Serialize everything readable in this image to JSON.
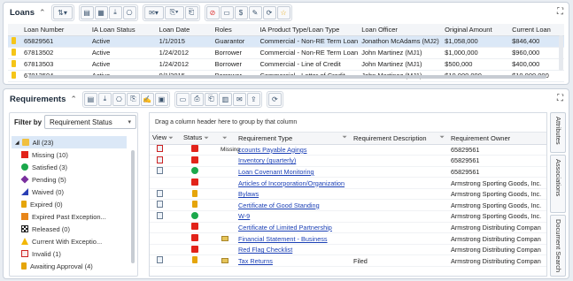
{
  "loans": {
    "title": "Loans",
    "columns": [
      "Loan Number",
      "IA Loan Status",
      "Loan Date",
      "Roles",
      "IA Product Type/Loan Type",
      "Loan Officer",
      "Original Amount",
      "Current Loan"
    ],
    "rows": [
      [
        "65829561",
        "Active",
        "1/1/2015",
        "Guarantor",
        "Commercial - Non-RE Term Loan",
        "Jonathon McAdams (MJ2)",
        "$1,058,000",
        "$846,400"
      ],
      [
        "67813502",
        "Active",
        "1/24/2012",
        "Borrower",
        "Commercial - Non-RE Term Loan",
        "John Martinez (MJ1)",
        "$1,000,000",
        "$960,000"
      ],
      [
        "67813503",
        "Active",
        "1/24/2012",
        "Borrower",
        "Commercial - Line of Credit",
        "John Martinez (MJ1)",
        "$500,000",
        "$400,000"
      ],
      [
        "67813504",
        "Active",
        "9/1/2015",
        "Borrower",
        "Commercial - Letter of Credit",
        "John Martinez (MJ1)",
        "$10,000,000",
        "$10,000,000"
      ]
    ]
  },
  "requirements": {
    "title": "Requirements",
    "filter_label": "Filter by",
    "filter_value": "Requirement Status",
    "filter_items": [
      {
        "label": "All (23)",
        "icon": "folder-icon",
        "color": "#f0c040"
      },
      {
        "label": "Missing (10)",
        "icon": "red-square-icon",
        "color": "#e2231a"
      },
      {
        "label": "Satisfied (3)",
        "icon": "green-circle-icon",
        "color": "#1aa84b"
      },
      {
        "label": "Pending (5)",
        "icon": "purple-diamond-icon",
        "color": "#7a2f9e"
      },
      {
        "label": "Waived (0)",
        "icon": "blue-triangle-icon",
        "color": "#2a3fb5"
      },
      {
        "label": "Expired (0)",
        "icon": "lock-icon",
        "color": "#e5a50a"
      },
      {
        "label": "Expired Past Exception...",
        "icon": "orange-square-icon",
        "color": "#e8861a"
      },
      {
        "label": "Released (0)",
        "icon": "checkered-flag-icon",
        "color": "#222222"
      },
      {
        "label": "Current With Exceptio...",
        "icon": "warning-icon",
        "color": "#f2b705"
      },
      {
        "label": "Invalid (1)",
        "icon": "invalid-doc-icon",
        "color": "#c22222"
      },
      {
        "label": "Awaiting Approval (4)",
        "icon": "lock-icon",
        "color": "#e5a50a"
      }
    ],
    "group_hint": "Drag a column header here to group by that column",
    "columns": {
      "view": "View",
      "status": "Status",
      "type": "Requirement Type",
      "desc": "Requirement Description",
      "owner": "Requirement Owner"
    },
    "rows": [
      {
        "view": "doc-red",
        "status": "red",
        "extra": "Missing",
        "type": "ccounts Payable Agings",
        "desc": "",
        "owner": "65829561"
      },
      {
        "view": "doc-red",
        "status": "green",
        "extra": "",
        "type": "Inventory (quarterly)",
        "desc": "",
        "owner": "65829561"
      },
      {
        "view": "doc",
        "status": "green",
        "extra": "",
        "type": "Loan Covenant Monitoring",
        "desc": "",
        "owner": "65829561"
      },
      {
        "view": "",
        "status": "red",
        "extra": "",
        "type": "Articles of Incorporation/Organization",
        "desc": "",
        "owner": "Armstrong Sporting Goods, Inc."
      },
      {
        "view": "doc",
        "status": "lock",
        "extra": "",
        "type": "Bylaws",
        "desc": "",
        "owner": "Armstrong Sporting Goods, Inc."
      },
      {
        "view": "doc",
        "status": "lock",
        "extra": "",
        "type": "Certificate of Good Standing",
        "desc": "",
        "owner": "Armstrong Sporting Goods, Inc."
      },
      {
        "view": "doc",
        "status": "green",
        "extra": "",
        "type": "W-9",
        "desc": "",
        "owner": "Armstrong Sporting Goods, Inc."
      },
      {
        "view": "",
        "status": "red",
        "extra": "",
        "type": "Certificate of Limited Partnership",
        "desc": "",
        "owner": "Armstrong Distributing Compan"
      },
      {
        "view": "",
        "status": "red",
        "extra": "env",
        "type": "Financial Statement - Business",
        "desc": "",
        "owner": "Armstrong Distributing Compan"
      },
      {
        "view": "",
        "status": "red",
        "extra": "",
        "type": "Red Flag Checklist",
        "desc": "",
        "owner": "Armstrong Distributing Compan"
      },
      {
        "view": "doc",
        "status": "lock",
        "extra": "env",
        "type": "Tax Returns",
        "desc": "Filed",
        "owner": "Armstrong Distributing Compan"
      }
    ],
    "side_tabs": [
      "Attributes",
      "Associations",
      "Document Search"
    ]
  }
}
